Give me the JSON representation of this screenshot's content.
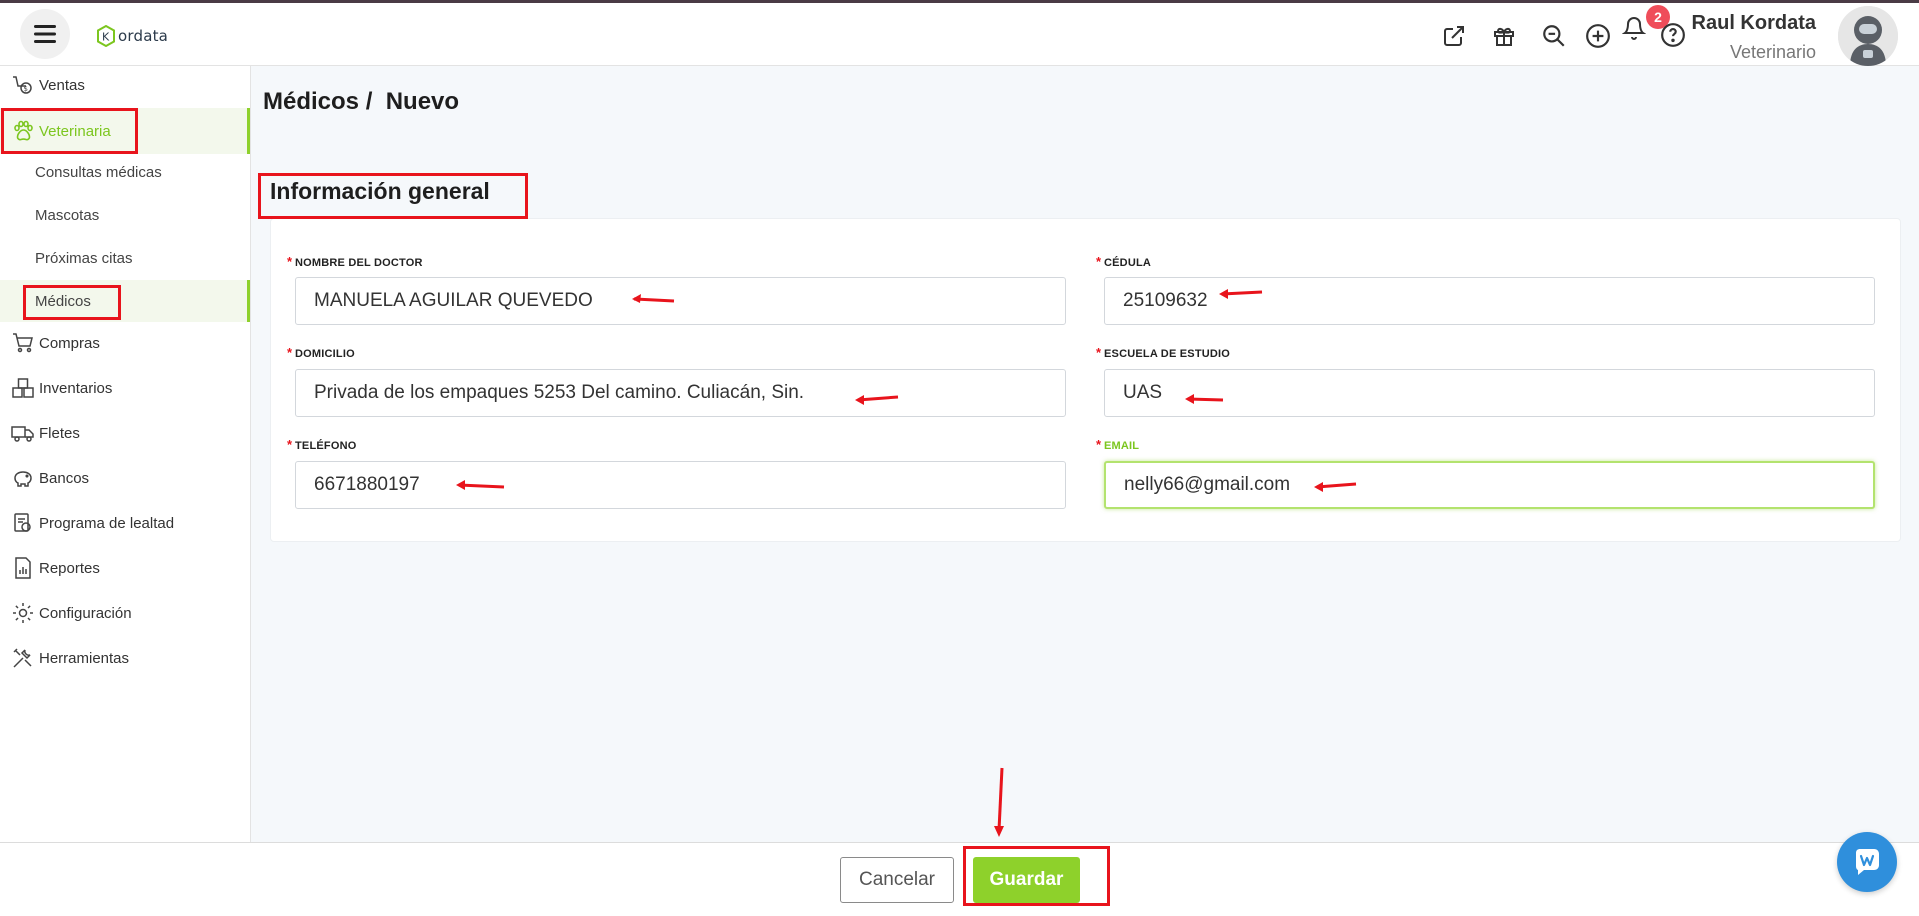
{
  "app": {
    "logo_text": "ordata"
  },
  "header": {
    "notification_count": "2",
    "user_name": "Raul Kordata",
    "user_role": "Veterinario"
  },
  "sidebar": {
    "items": [
      {
        "label": "Ventas",
        "icon": "sales-icon"
      },
      {
        "label": "Veterinaria",
        "icon": "paw-icon",
        "active": true
      },
      {
        "label": "Compras",
        "icon": "cart-icon"
      },
      {
        "label": "Inventarios",
        "icon": "boxes-icon"
      },
      {
        "label": "Fletes",
        "icon": "truck-icon"
      },
      {
        "label": "Bancos",
        "icon": "piggy-bank-icon"
      },
      {
        "label": "Programa de lealtad",
        "icon": "loyalty-icon"
      },
      {
        "label": "Reportes",
        "icon": "report-icon"
      },
      {
        "label": "Configuración",
        "icon": "gear-icon"
      },
      {
        "label": "Herramientas",
        "icon": "tools-icon"
      }
    ],
    "sub_items": [
      {
        "label": "Consultas médicas"
      },
      {
        "label": "Mascotas"
      },
      {
        "label": "Próximas citas"
      },
      {
        "label": "Médicos",
        "active": true
      }
    ]
  },
  "page": {
    "breadcrumb": "Médicos /  Nuevo",
    "section_title": "Información general"
  },
  "form": {
    "doctor_name": {
      "label": "NOMBRE DEL DOCTOR",
      "value": "MANUELA AGUILAR QUEVEDO"
    },
    "cedula": {
      "label": "CÉDULA",
      "value": "25109632"
    },
    "address": {
      "label": "DOMICILIO",
      "value": "Privada de los empaques 5253 Del camino. Culiacán, Sin."
    },
    "school": {
      "label": "ESCUELA DE ESTUDIO",
      "value": "UAS"
    },
    "phone": {
      "label": "TELÉFONO",
      "value": "6671880197"
    },
    "email": {
      "label": "EMAIL",
      "value": "nelly66@gmail.com"
    }
  },
  "footer": {
    "cancel_label": "Cancelar",
    "save_label": "Guardar"
  },
  "colors": {
    "accent": "#8ed12b",
    "annotation": "#e8141c",
    "badge": "#ef4d5a",
    "chat": "#2f8fdc"
  }
}
